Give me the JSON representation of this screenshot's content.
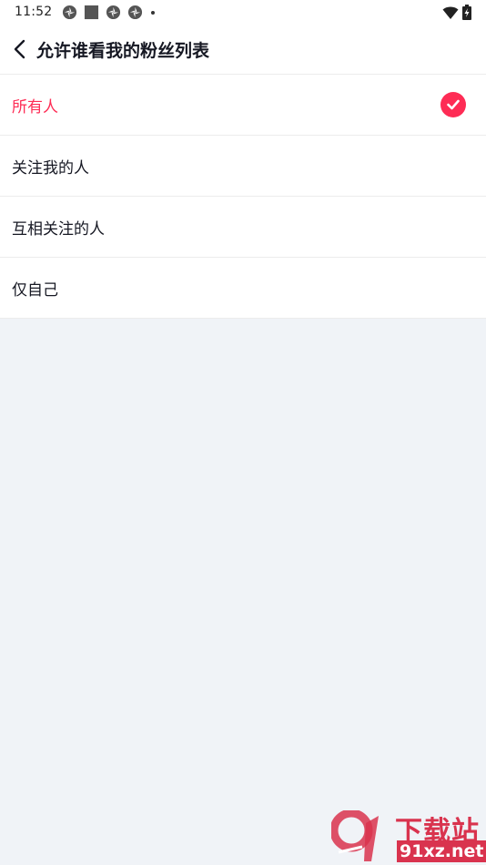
{
  "status_bar": {
    "time": "11:52",
    "notification_icons": [
      "app-notification-icon",
      "square-notification-icon",
      "app-notification-icon",
      "app-notification-icon"
    ],
    "wifi_icon": "wifi-icon",
    "battery_icon": "battery-charging-icon"
  },
  "header": {
    "back_icon": "chevron-left-icon",
    "title": "允许谁看我的粉丝列表"
  },
  "options": [
    {
      "label": "所有人",
      "selected": true
    },
    {
      "label": "关注我的人",
      "selected": false
    },
    {
      "label": "互相关注的人",
      "selected": false
    },
    {
      "label": "仅自己",
      "selected": false
    }
  ],
  "watermark": {
    "brand_text": "下载站",
    "domain_text": "91xz.net"
  },
  "colors": {
    "accent": "#fe2c55",
    "page_background": "#f0f3f7",
    "text_primary": "#161823",
    "divider": "#ececec"
  }
}
